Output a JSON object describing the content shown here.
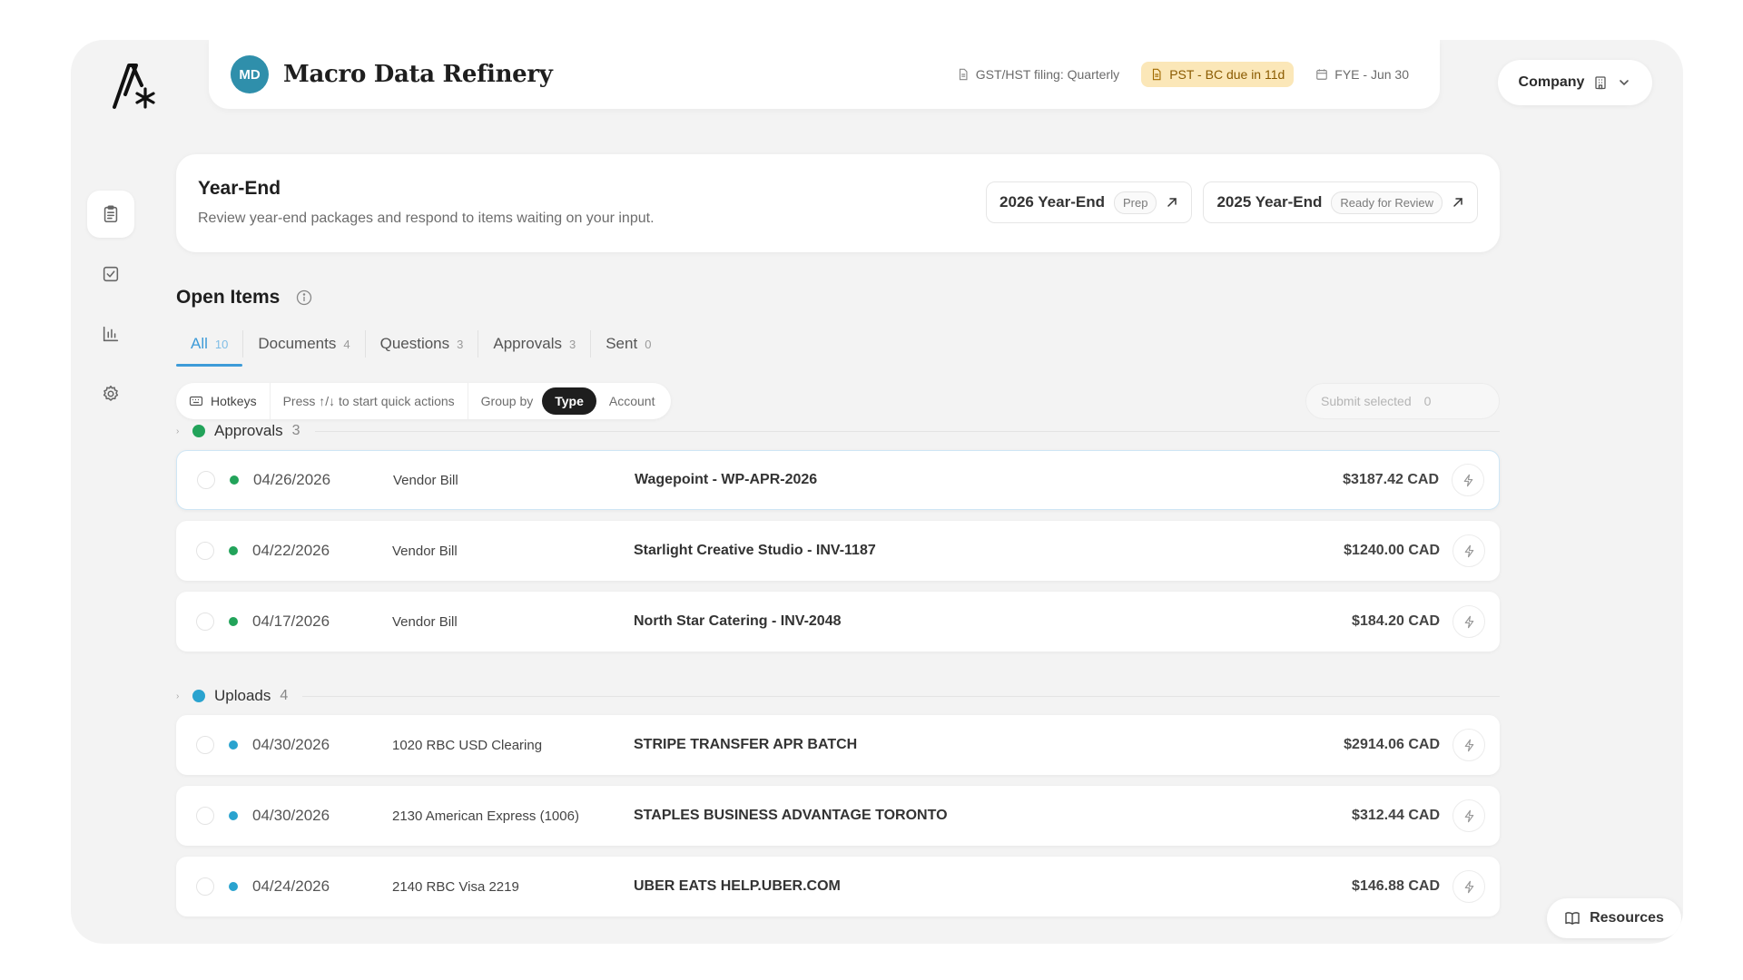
{
  "topbar": {
    "avatar_initials": "MD",
    "company_name": "Macro Data Refinery",
    "chips": [
      {
        "icon": "document-icon",
        "label": "GST/HST filing: Quarterly"
      },
      {
        "icon": "document-icon",
        "label": "PST - BC due in 11d",
        "status_color": "#fbe7b8"
      },
      {
        "icon": "calendar-icon",
        "label": "FYE - Jun 30"
      }
    ]
  },
  "company_switcher": {
    "label": "Company",
    "icon": "building-icon"
  },
  "sidebar": {
    "items": [
      {
        "icon": "clipboard-icon",
        "active": true
      },
      {
        "icon": "checkbox-icon"
      },
      {
        "icon": "bar-chart-icon"
      },
      {
        "icon": "gear-icon"
      }
    ]
  },
  "year_end": {
    "title": "Year-End",
    "description": "Review year-end packages and respond to items waiting on your input.",
    "cards": [
      {
        "label": "2026 Year-End",
        "status": "Prep"
      },
      {
        "label": "2025 Year-End",
        "status": "Ready for Review"
      }
    ]
  },
  "open_items": {
    "title": "Open Items",
    "tabs": [
      {
        "label": "All",
        "count": "10"
      },
      {
        "label": "Documents",
        "count": "4"
      },
      {
        "label": "Questions",
        "count": "3"
      },
      {
        "label": "Approvals",
        "count": "3"
      },
      {
        "label": "Sent",
        "count": "0"
      }
    ],
    "toolbar": {
      "hotkeys_label": "Hotkeys",
      "hint": "Press ↑/↓ to start quick actions",
      "group_by_label": "Group by",
      "group_options": [
        "Type",
        "Account"
      ],
      "submit_label": "Submit selected",
      "submit_count": "0"
    },
    "groups": [
      {
        "label": "Approvals",
        "count": "3",
        "color": "#22a35a",
        "rows": [
          {
            "date": "04/26/2026",
            "account": "Vendor Bill",
            "description": "Wagepoint - WP-APR-2026",
            "amount": "$3187.42 CAD"
          },
          {
            "date": "04/22/2026",
            "account": "Vendor Bill",
            "description": "Starlight Creative Studio - INV-1187",
            "amount": "$1240.00 CAD"
          },
          {
            "date": "04/17/2026",
            "account": "Vendor Bill",
            "description": "North Star Catering - INV-2048",
            "amount": "$184.20 CAD"
          }
        ]
      },
      {
        "label": "Uploads",
        "count": "4",
        "color": "#2aa3cf",
        "rows": [
          {
            "date": "04/30/2026",
            "account": "1020 RBC USD Clearing",
            "description": "STRIPE TRANSFER APR BATCH",
            "amount": "$2914.06 CAD"
          },
          {
            "date": "04/30/2026",
            "account": "2130 American Express (1006)",
            "description": "STAPLES BUSINESS ADVANTAGE TORONTO",
            "amount": "$312.44 CAD"
          },
          {
            "date": "04/24/2026",
            "account": "2140 RBC Visa 2219",
            "description": "UBER EATS HELP.UBER.COM",
            "amount": "$146.88 CAD"
          }
        ]
      }
    ]
  },
  "resources": {
    "label": "Resources",
    "icon": "book-icon"
  }
}
